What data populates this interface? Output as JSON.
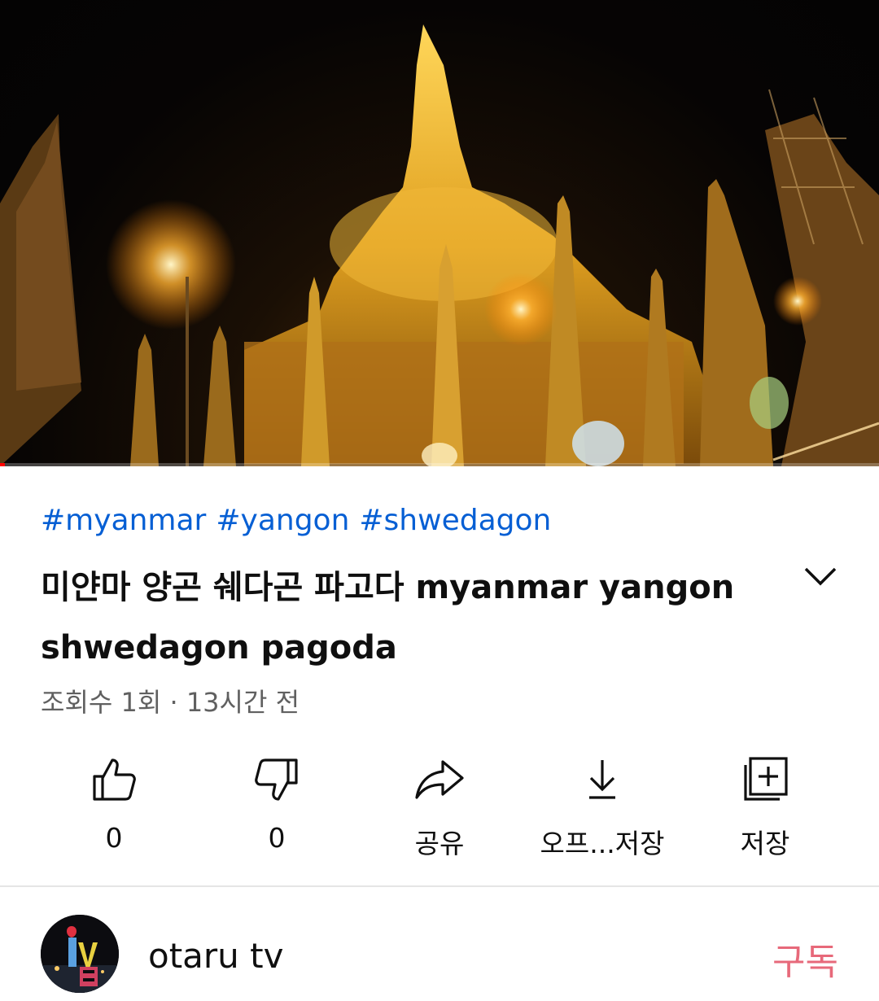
{
  "player": {
    "thumbnail_icon": "video-frame",
    "progress_fraction": 0.005,
    "progress_color": "#ff0000"
  },
  "video": {
    "hashtags": [
      "#myanmar",
      "#yangon",
      "#shwedagon"
    ],
    "title": "미얀마 양곤 쉐다곤 파고다 myanmar yangon shwedagon pagoda",
    "expand_icon": "chevron-down-icon",
    "views": "조회수 1회",
    "separator": "·",
    "age": "13시간 전"
  },
  "actions": [
    {
      "id": "like",
      "icon": "thumbs-up-icon",
      "label": "0"
    },
    {
      "id": "dislike",
      "icon": "thumbs-down-icon",
      "label": "0"
    },
    {
      "id": "share",
      "icon": "share-icon",
      "label": "공유"
    },
    {
      "id": "download",
      "icon": "download-icon",
      "label": "오프...저장"
    },
    {
      "id": "save",
      "icon": "add-to-playlist-icon",
      "label": "저장"
    }
  ],
  "channel": {
    "name": "otaru tv",
    "subscribe_label": "구독",
    "subscribe_color": "#e7697a",
    "link_color": "#065fd4"
  }
}
